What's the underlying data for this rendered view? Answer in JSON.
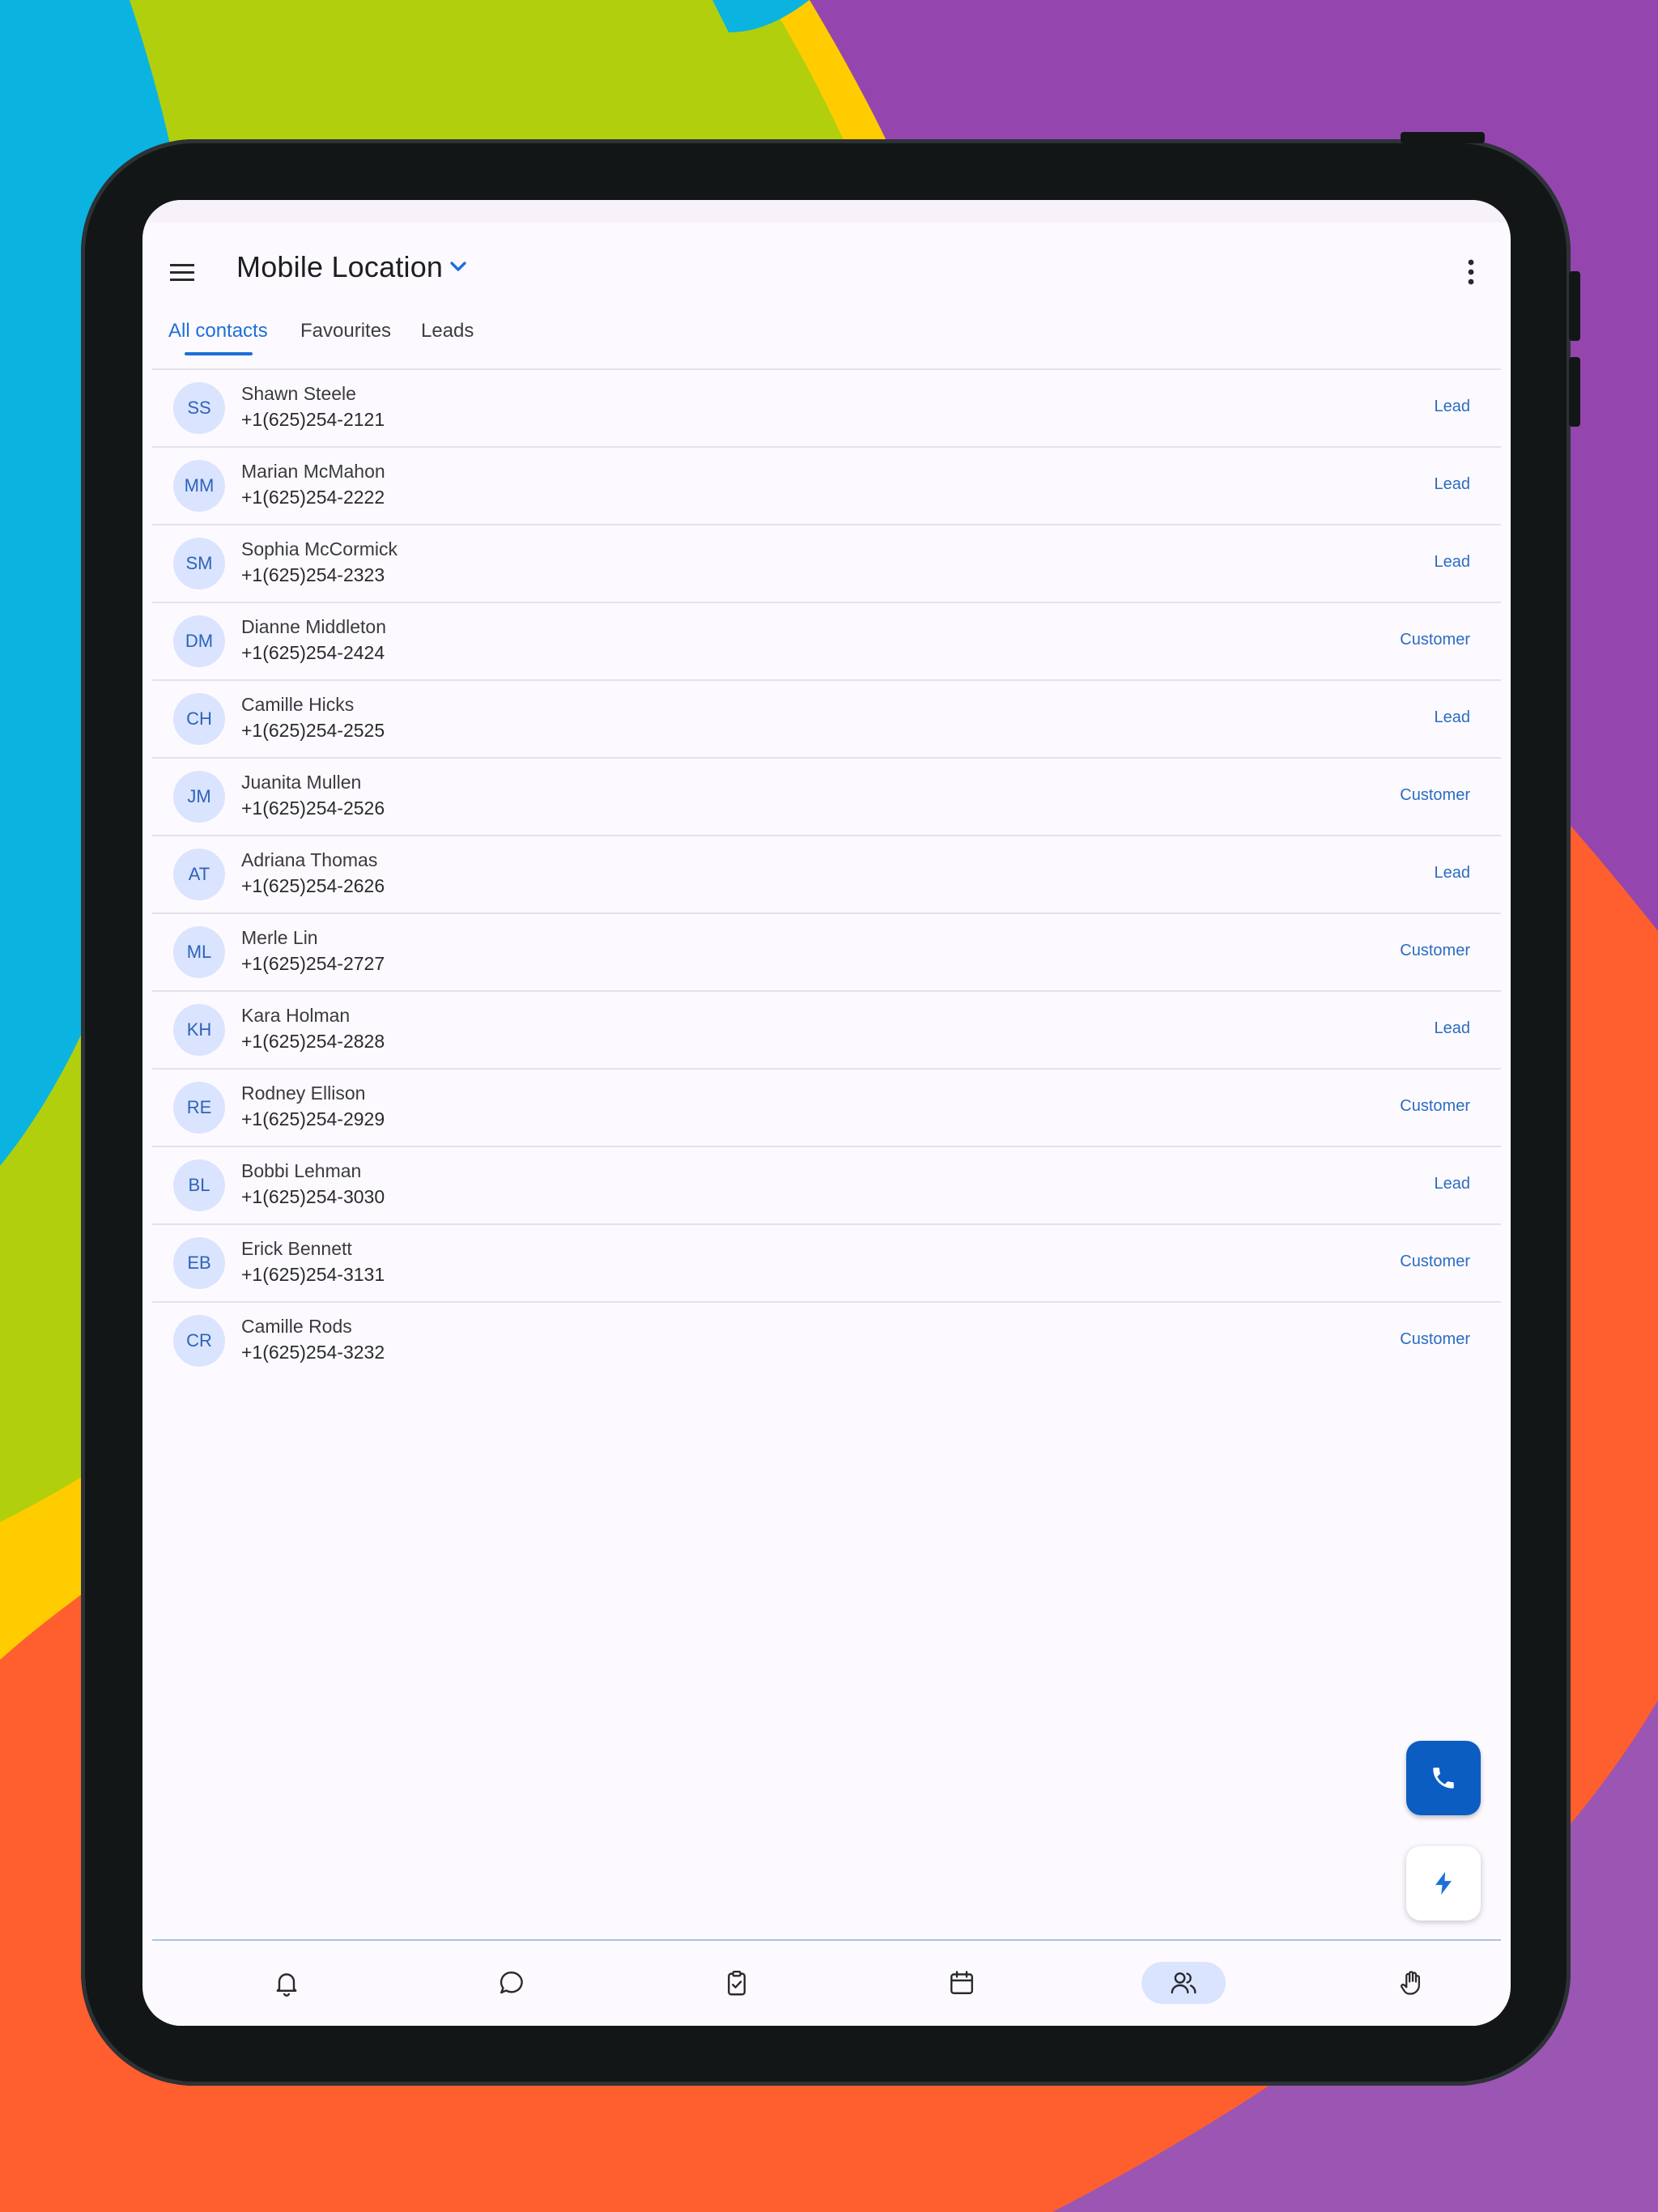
{
  "app": {
    "title": "Mobile Location"
  },
  "tabs": [
    {
      "label": "All contacts",
      "active": true
    },
    {
      "label": "Favourites",
      "active": false
    },
    {
      "label": "Leads",
      "active": false
    }
  ],
  "contacts": [
    {
      "initials": "SS",
      "name": "Shawn Steele",
      "phone": "+1(625)254-2121",
      "type": "Lead"
    },
    {
      "initials": "MM",
      "name": "Marian McMahon",
      "phone": "+1(625)254-2222",
      "type": "Lead"
    },
    {
      "initials": "SM",
      "name": "Sophia McCormick",
      "phone": "+1(625)254-2323",
      "type": "Lead"
    },
    {
      "initials": "DM",
      "name": "Dianne Middleton",
      "phone": "+1(625)254-2424",
      "type": "Customer"
    },
    {
      "initials": "CH",
      "name": "Camille Hicks",
      "phone": "+1(625)254-2525",
      "type": "Lead"
    },
    {
      "initials": "JM",
      "name": "Juanita Mullen",
      "phone": "+1(625)254-2526",
      "type": "Customer"
    },
    {
      "initials": "AT",
      "name": "Adriana Thomas",
      "phone": "+1(625)254-2626",
      "type": "Lead"
    },
    {
      "initials": "ML",
      "name": "Merle Lin",
      "phone": "+1(625)254-2727",
      "type": "Customer"
    },
    {
      "initials": "KH",
      "name": "Kara Holman",
      "phone": "+1(625)254-2828",
      "type": "Lead"
    },
    {
      "initials": "RE",
      "name": "Rodney Ellison",
      "phone": "+1(625)254-2929",
      "type": "Customer"
    },
    {
      "initials": "BL",
      "name": "Bobbi Lehman",
      "phone": "+1(625)254-3030",
      "type": "Lead"
    },
    {
      "initials": "EB",
      "name": "Erick Bennett",
      "phone": "+1(625)254-3131",
      "type": "Customer"
    },
    {
      "initials": "CR",
      "name": "Camille Rods",
      "phone": "+1(625)254-3232",
      "type": "Customer"
    }
  ],
  "fab": {
    "call_icon": "phone-icon",
    "quick_action_icon": "bolt-icon"
  },
  "bottom_nav": [
    {
      "icon": "bell-icon",
      "active": false
    },
    {
      "icon": "chat-bubble-icon",
      "active": false
    },
    {
      "icon": "clipboard-check-icon",
      "active": false
    },
    {
      "icon": "calendar-icon",
      "active": false
    },
    {
      "icon": "contacts-icon",
      "active": true
    },
    {
      "icon": "raised-hand-icon",
      "active": false
    }
  ],
  "colors": {
    "accent": "#1E6FD9",
    "fab_primary": "#0B5DC2",
    "avatar_bg": "#DAE4FF",
    "screen_bg": "#FDFAFF",
    "wallpaper": [
      "#0BB4E0",
      "#B2CF0E",
      "#FFCC00",
      "#FF5F2E",
      "#9446AE"
    ]
  }
}
